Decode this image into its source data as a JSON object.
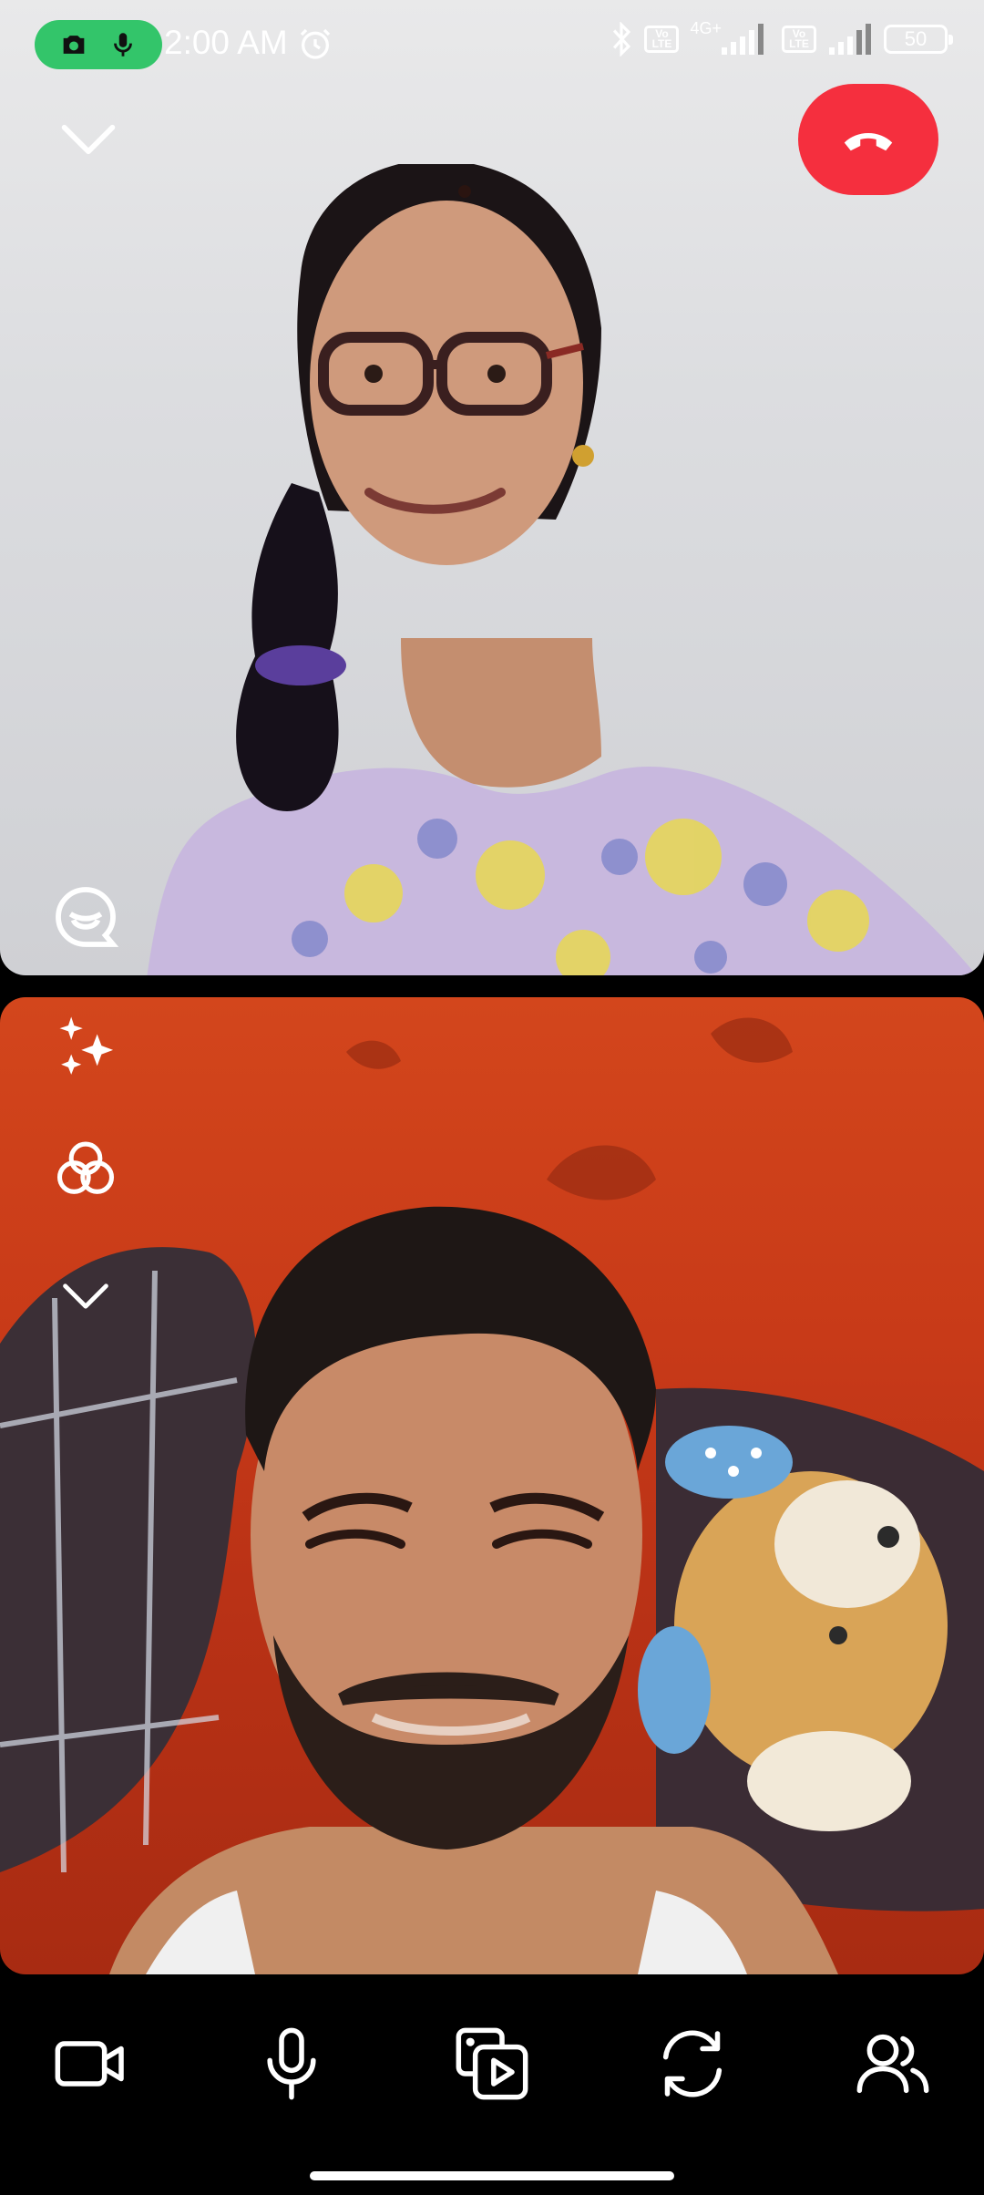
{
  "status_bar": {
    "time": "2:00 AM",
    "network_label": "4G+",
    "volte_label_1": "Vo\nLTE",
    "volte_label_2": "Vo\nLTE",
    "battery_level": "50",
    "indicator_color": "#33c56a",
    "icons": [
      "camera-in-use-icon",
      "mic-in-use-icon",
      "alarm-icon",
      "bluetooth-icon",
      "signal-icon",
      "battery-icon"
    ]
  },
  "call": {
    "end_call_color": "#f52f3e",
    "remote_video": {
      "controls": [
        "collapse-icon",
        "end-call-icon",
        "reaction-icon"
      ]
    },
    "local_video": {
      "controls": [
        "sparkle-effects-icon",
        "filters-icon",
        "collapse-icon"
      ]
    }
  },
  "bottom_bar": {
    "buttons": [
      "video-camera-icon",
      "microphone-icon",
      "media-share-icon",
      "flip-camera-icon",
      "participants-icon"
    ]
  }
}
